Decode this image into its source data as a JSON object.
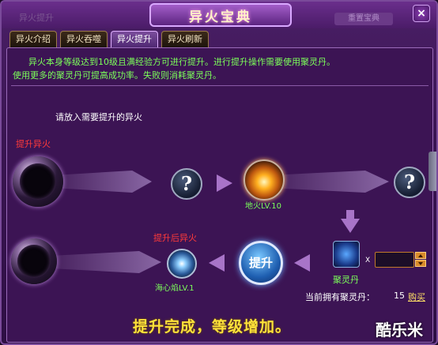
{
  "window": {
    "title": "异火宝典",
    "faint_title": "异火提升",
    "faint_right": "重置宝典",
    "close_label": "×"
  },
  "tabs": [
    {
      "label": "异火介绍",
      "active": false
    },
    {
      "label": "异火吞噬",
      "active": false
    },
    {
      "label": "异火提升",
      "active": true
    },
    {
      "label": "异火刷新",
      "active": false
    }
  ],
  "description": {
    "line1": "异火本身等级达到10级且满经验方可进行提升。进行提升操作需要使用聚灵丹。",
    "line2": "使用更多的聚灵丹可提高成功率。失败则消耗聚灵丹。"
  },
  "hint": "请放入需要提升的异火",
  "labels": {
    "source_fire": "提升异火",
    "result_fire": "提升后异火",
    "fire_name": "地火LV.10",
    "ice_name": "海心焰LV.1",
    "upgrade_button": "提升",
    "unknown_mark": "?",
    "item_name": "聚灵丹",
    "multiplier": "X",
    "owned_label": "当前拥有聚灵丹：",
    "owned_count": "15",
    "buy_link": "购买",
    "result_text": "提升完成，等级增加。",
    "watermark": "酷乐米"
  },
  "icons": {
    "empty_orb": "empty-orb-icon",
    "fire_orb": "earth-fire-icon",
    "ice_orb": "sea-heart-flame-icon",
    "item": "spirit-pill-icon"
  },
  "colors": {
    "description": "#7cff5a",
    "red_label": "#ff3a3a",
    "result": "#ffe23a",
    "panel": "#3c1454"
  }
}
